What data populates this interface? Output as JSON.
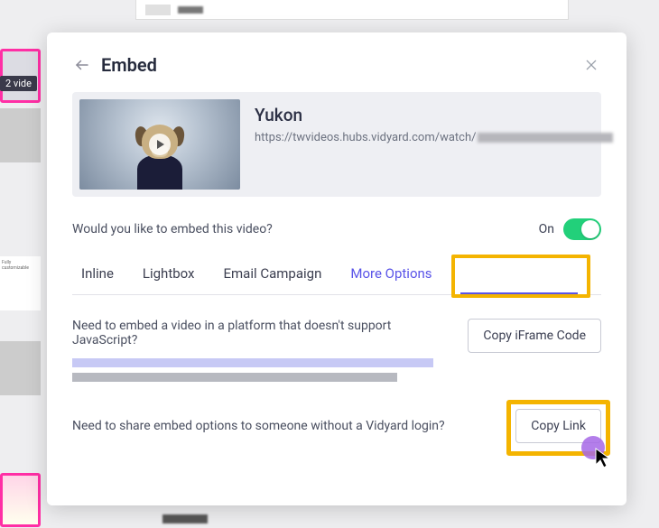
{
  "bg": {
    "sidebar_badge": "2 vide",
    "thumb_text": "Fully customizable"
  },
  "modal": {
    "title": "Embed",
    "video": {
      "title": "Yukon",
      "url_prefix": "https://twvideos.hubs.vidyard.com/watch/"
    },
    "embed_question": "Would you like to embed this video?",
    "toggle_label": "On",
    "tabs": {
      "inline": "Inline",
      "lightbox": "Lightbox",
      "email": "Email Campaign",
      "more": "More Options"
    },
    "iframe_section": {
      "text": "Need to embed a video in a platform that doesn't support JavaScript?",
      "button": "Copy iFrame Code"
    },
    "share_section": {
      "text": "Need to share embed options to someone without a Vidyard login?",
      "button": "Copy Link"
    }
  }
}
